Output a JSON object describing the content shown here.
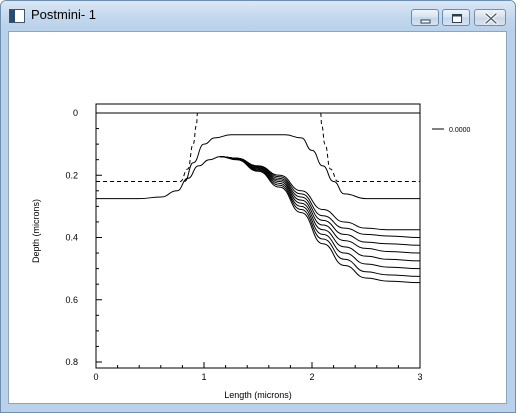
{
  "window": {
    "title": "Postmini- 1"
  },
  "icons": {
    "app": "app-window-icon",
    "minimize": "minimize-icon",
    "maximize": "maximize-icon",
    "close": "close-icon"
  },
  "chart_data": {
    "type": "line",
    "title": "",
    "xlabel": "Length (microns)",
    "ylabel": "Depth (microns)",
    "xlim": [
      0,
      3
    ],
    "ylim": [
      0,
      0.8
    ],
    "y_inverted": true,
    "xticks": [
      "0",
      "1",
      "2",
      "3"
    ],
    "yticks": [
      "0",
      "0.2",
      "0.4",
      "0.6",
      "0.8"
    ],
    "legend": {
      "position": "top-right",
      "entries": [
        "0.0000"
      ]
    },
    "series": [
      {
        "style": "solid",
        "x": [
          0,
          3
        ],
        "y": [
          0,
          0
        ]
      },
      {
        "style": "dashed",
        "x": [
          0,
          0.78,
          0.85,
          0.9,
          0.93,
          0.94
        ],
        "y": [
          0.22,
          0.22,
          0.18,
          0.1,
          0.04,
          0
        ]
      },
      {
        "style": "dashed",
        "x": [
          2.08,
          2.09,
          2.12,
          2.17,
          2.24,
          3
        ],
        "y": [
          0,
          0.04,
          0.1,
          0.18,
          0.22,
          0.22
        ]
      },
      {
        "style": "solid",
        "x": [
          0.82,
          0.9,
          1.0,
          1.1,
          1.25,
          1.5,
          1.75,
          1.9,
          2.0,
          2.1,
          2.2,
          2.3,
          2.5,
          3.0
        ],
        "y": [
          0.22,
          0.16,
          0.1,
          0.08,
          0.07,
          0.07,
          0.07,
          0.08,
          0.12,
          0.17,
          0.22,
          0.26,
          0.275,
          0.275
        ]
      },
      {
        "style": "solid",
        "x": [
          0,
          0.4,
          0.6,
          0.75,
          0.85,
          0.95,
          1.05,
          1.15,
          1.3,
          1.5,
          1.7,
          1.9,
          2.1,
          2.3,
          2.5,
          2.7,
          3.0
        ],
        "y": [
          0.275,
          0.275,
          0.27,
          0.25,
          0.21,
          0.17,
          0.15,
          0.14,
          0.145,
          0.17,
          0.2,
          0.25,
          0.31,
          0.35,
          0.37,
          0.375,
          0.375
        ]
      },
      {
        "style": "solid",
        "x": [
          1.15,
          1.3,
          1.5,
          1.7,
          1.9,
          2.1,
          2.3,
          2.5,
          2.7,
          3.0
        ],
        "y": [
          0.14,
          0.145,
          0.17,
          0.205,
          0.26,
          0.33,
          0.37,
          0.39,
          0.395,
          0.4
        ]
      },
      {
        "style": "solid",
        "x": [
          1.15,
          1.3,
          1.5,
          1.7,
          1.9,
          2.1,
          2.3,
          2.5,
          2.7,
          3.0
        ],
        "y": [
          0.14,
          0.145,
          0.172,
          0.21,
          0.27,
          0.345,
          0.39,
          0.415,
          0.42,
          0.425
        ]
      },
      {
        "style": "solid",
        "x": [
          1.15,
          1.3,
          1.5,
          1.7,
          1.9,
          2.1,
          2.3,
          2.5,
          2.7,
          3.0
        ],
        "y": [
          0.14,
          0.146,
          0.175,
          0.215,
          0.28,
          0.36,
          0.41,
          0.435,
          0.445,
          0.45
        ]
      },
      {
        "style": "solid",
        "x": [
          1.15,
          1.3,
          1.5,
          1.7,
          1.9,
          2.1,
          2.3,
          2.5,
          2.7,
          3.0
        ],
        "y": [
          0.14,
          0.147,
          0.178,
          0.22,
          0.29,
          0.375,
          0.43,
          0.46,
          0.47,
          0.475
        ]
      },
      {
        "style": "solid",
        "x": [
          1.15,
          1.3,
          1.5,
          1.7,
          1.9,
          2.1,
          2.3,
          2.5,
          2.7,
          3.0
        ],
        "y": [
          0.14,
          0.148,
          0.181,
          0.226,
          0.3,
          0.39,
          0.45,
          0.485,
          0.495,
          0.5
        ]
      },
      {
        "style": "solid",
        "x": [
          1.15,
          1.3,
          1.5,
          1.7,
          1.9,
          2.1,
          2.3,
          2.5,
          2.7,
          3.0
        ],
        "y": [
          0.14,
          0.149,
          0.184,
          0.232,
          0.31,
          0.405,
          0.47,
          0.51,
          0.52,
          0.525
        ]
      },
      {
        "style": "solid",
        "x": [
          1.15,
          1.3,
          1.5,
          1.7,
          1.9,
          2.1,
          2.3,
          2.5,
          2.7,
          3.0
        ],
        "y": [
          0.14,
          0.15,
          0.187,
          0.238,
          0.32,
          0.42,
          0.49,
          0.53,
          0.54,
          0.545
        ]
      }
    ]
  }
}
